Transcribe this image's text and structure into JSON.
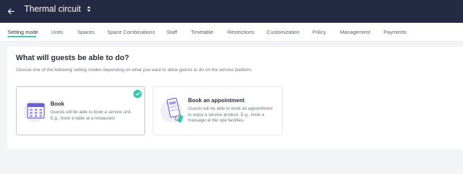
{
  "header": {
    "back_icon": "arrow-left-icon",
    "title": "Thermal circuit",
    "title_sort_icon": "sort-updown-icon"
  },
  "tabs": [
    {
      "label": "Setting mode",
      "active": true
    },
    {
      "label": "Units"
    },
    {
      "label": "Spaces"
    },
    {
      "label": "Space Combinations"
    },
    {
      "label": "Staff"
    },
    {
      "label": "Timetable"
    },
    {
      "label": "Restrictions"
    },
    {
      "label": "Customization"
    },
    {
      "label": "Policy"
    },
    {
      "label": "Management"
    },
    {
      "label": "Payments"
    }
  ],
  "main": {
    "heading": "What will guests be able to do?",
    "subtitle": "Choose one of the following setting modes depending on what you want to allow guests to do on the service platform.",
    "options": [
      {
        "title": "Book",
        "description": "Guests will be able to book a service unit. E.g., book a table at a restaurant.",
        "selected": true,
        "icon": "calendar-icon"
      },
      {
        "title": "Book an appointment",
        "description": "Guests will be able to book an appointment to enjoy a service product. E.g., book a massage at the spa facilities.",
        "selected": false,
        "icon": "phone-booking-icon"
      }
    ]
  },
  "colors": {
    "header_bg": "#252a44",
    "accent": "#35c8b6",
    "illustration_purple": "#6b5fc9"
  }
}
